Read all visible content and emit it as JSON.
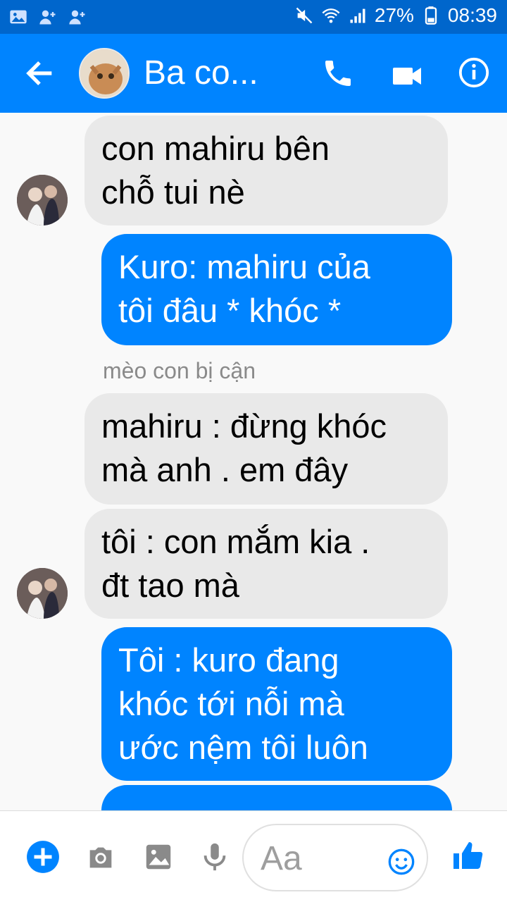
{
  "status_bar": {
    "battery": "27%",
    "time": "08:39"
  },
  "header": {
    "title": "Ba co..."
  },
  "messages": [
    {
      "direction": "in",
      "text_line1": "con mahiru bên",
      "text_line2": "chỗ tui nè"
    },
    {
      "direction": "out",
      "text_line1": "Kuro: mahiru của",
      "text_line2": "tôi đâu * khóc *"
    },
    {
      "sender": "mèo con bị cận"
    },
    {
      "direction": "in",
      "text_line1": "mahiru : đừng khóc",
      "text_line2": "mà anh . em đây"
    },
    {
      "direction": "in",
      "text_line1": "tôi : con mắm kia .",
      "text_line2": "đt tao mà"
    },
    {
      "direction": "out",
      "text_line1": "Tôi : kuro đang",
      "text_line2": "khóc tới nỗi mà",
      "text_line3": "ước nệm tôi luôn"
    }
  ],
  "composer": {
    "placeholder": "Aa"
  },
  "colors": {
    "accent": "#0084ff",
    "status_bar": "#0066cc",
    "incoming_bubble": "#e9e9e9"
  },
  "icons": [
    "image-icon",
    "add-person-icon",
    "mute-icon",
    "wifi-icon",
    "signal-icon",
    "battery-icon",
    "back-arrow-icon",
    "phone-icon",
    "video-icon",
    "info-icon",
    "plus-icon",
    "camera-icon",
    "gallery-icon",
    "mic-icon",
    "emoji-icon",
    "like-icon"
  ]
}
